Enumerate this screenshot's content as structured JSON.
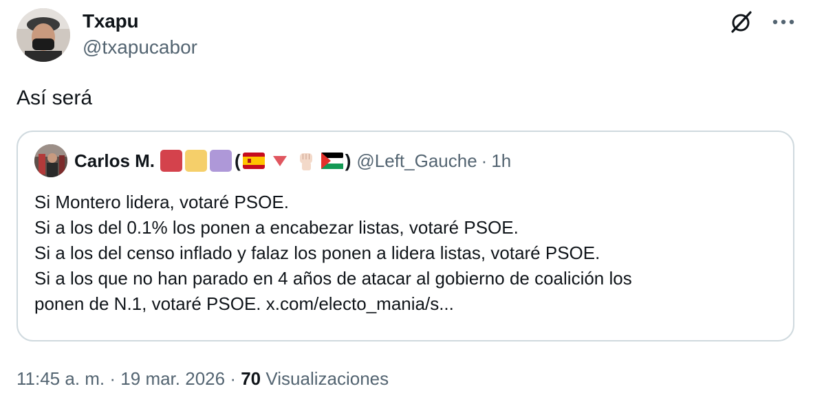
{
  "author": {
    "name": "Txapu",
    "handle": "@txapucabor"
  },
  "tweet": {
    "text": "Así será"
  },
  "quote": {
    "author_name": "Carlos M.",
    "name_decorations": [
      "red-square",
      "yellow-square",
      "purple-square",
      "(",
      "spain-flag-emoji",
      "red-triangle-emoji",
      "raised-fist-emoji",
      "palestine-flag-emoji",
      ")"
    ],
    "paren_open": "(",
    "paren_close": ")",
    "handle": "@Left_Gauche",
    "separator": "·",
    "time": "1h",
    "lines": [
      "Si Montero lidera, votaré PSOE.",
      "Si a los del 0.1% los ponen a encabezar listas, votaré PSOE.",
      "Si a los del censo inflado y falaz los ponen a lidera listas, votaré PSOE.",
      "Si a los que no han parado en 4 años de atacar al gobierno de coalición los",
      "ponen de N.1, votaré PSOE. x.com/electo_mania/s..."
    ]
  },
  "meta": {
    "time": "11:45 a. m.",
    "sep1": "·",
    "date": "19 mar. 2026",
    "sep2": "·",
    "views_count": "70",
    "views_label": "Visualizaciones"
  },
  "colors": {
    "text_primary": "#0f1419",
    "text_secondary": "#536471",
    "border": "#cfd9de",
    "square_red": "#d4424c",
    "square_yellow": "#f5cf6a",
    "square_purple": "#ae98d8"
  },
  "icons": {
    "top_left": "grok-icon",
    "top_right": "more-icon"
  }
}
